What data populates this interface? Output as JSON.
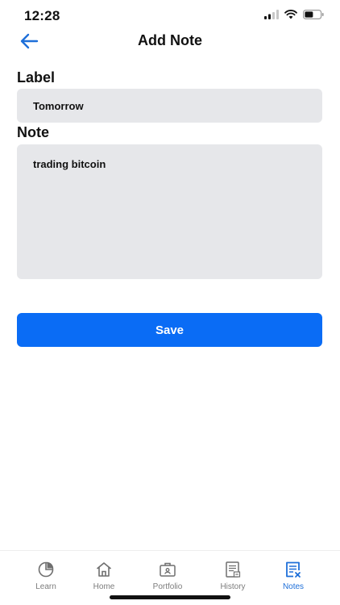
{
  "status_bar": {
    "time": "12:28",
    "icons": [
      "cellular-signal-icon",
      "wifi-icon",
      "battery-icon"
    ]
  },
  "header": {
    "title": "Add Note",
    "back_icon": "back-arrow-icon"
  },
  "form": {
    "label_heading": "Label",
    "label_value": "Tomorrow",
    "note_heading": "Note",
    "note_value": "trading bitcoin",
    "save_label": "Save"
  },
  "tabs": [
    {
      "label": "Learn",
      "icon": "pie-chart-icon",
      "active": false
    },
    {
      "label": "Home",
      "icon": "home-icon",
      "active": false
    },
    {
      "label": "Portfolio",
      "icon": "briefcase-icon",
      "active": false
    },
    {
      "label": "History",
      "icon": "receipt-icon",
      "active": false
    },
    {
      "label": "Notes",
      "icon": "notes-icon",
      "active": true
    }
  ],
  "colors": {
    "accent": "#0a6cf5",
    "active_tab": "#1e6fd9",
    "inactive_tab": "#7c7c7c",
    "input_background": "#e6e7ea"
  }
}
